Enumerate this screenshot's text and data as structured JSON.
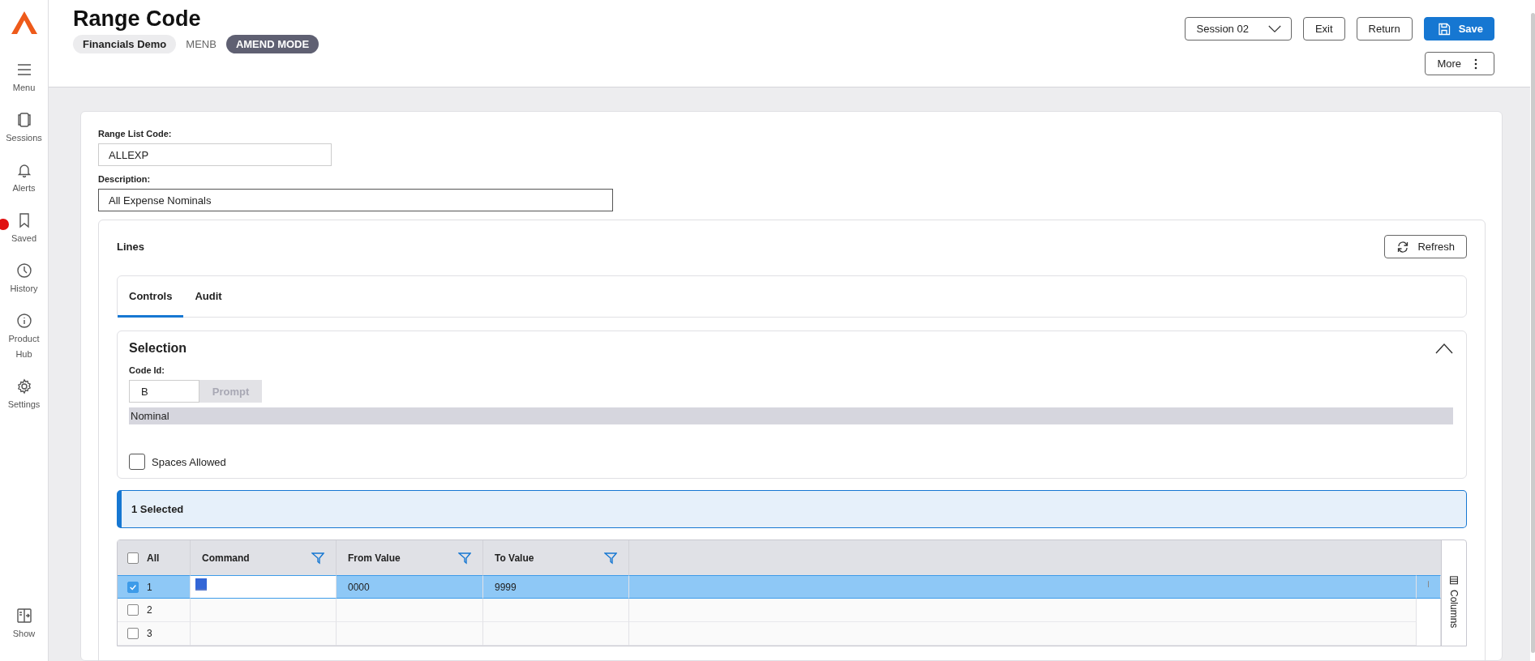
{
  "sidebar": {
    "items": [
      {
        "label": "Menu",
        "badge": false
      },
      {
        "label": "Sessions",
        "badge": false
      },
      {
        "label": "Alerts",
        "badge": false
      },
      {
        "label": "Saved",
        "badge": true
      },
      {
        "label": "History",
        "badge": false
      },
      {
        "label": "Product Hub",
        "badge": false
      },
      {
        "label": "Settings",
        "badge": false
      }
    ],
    "bottom": {
      "label": "Show"
    }
  },
  "header": {
    "title": "Range Code",
    "company": "Financials Demo",
    "code": "MENB",
    "mode": "AMEND MODE",
    "session": "Session 02",
    "buttons": [
      {
        "label": "Exit",
        "kind": "plain"
      },
      {
        "label": "Return",
        "kind": "plain"
      },
      {
        "label": "Save",
        "kind": "primary"
      }
    ],
    "more": "More"
  },
  "form": {
    "fields": [
      {
        "label": "Range List Code:",
        "value": "ALLEXP",
        "kind": "short"
      },
      {
        "label": "Description:",
        "value": "All Expense Nominals",
        "kind": "long"
      }
    ]
  },
  "lines": {
    "title": "Lines",
    "refresh": "Refresh",
    "tabs": [
      {
        "label": "Controls",
        "selected": true
      },
      {
        "label": "Audit",
        "selected": false
      }
    ],
    "selection": {
      "title": "Selection",
      "expanded": true,
      "code_label": "Code Id:",
      "code_value": "B",
      "prompt": "Prompt",
      "description": "Nominal",
      "spaces_label": "Spaces Allowed",
      "spaces_checked": false
    },
    "banner": "1 Selected",
    "grid": {
      "all_label": "All",
      "all_checked": false,
      "columns": [
        "Command",
        "From Value",
        "To Value"
      ],
      "columns_panel": "Columns",
      "rows": [
        {
          "number": "1",
          "selected": true,
          "editing": true,
          "from": "0000",
          "to": "9999"
        },
        {
          "number": "2",
          "selected": false,
          "editing": false
        },
        {
          "number": "3",
          "selected": false,
          "editing": false
        }
      ]
    }
  }
}
